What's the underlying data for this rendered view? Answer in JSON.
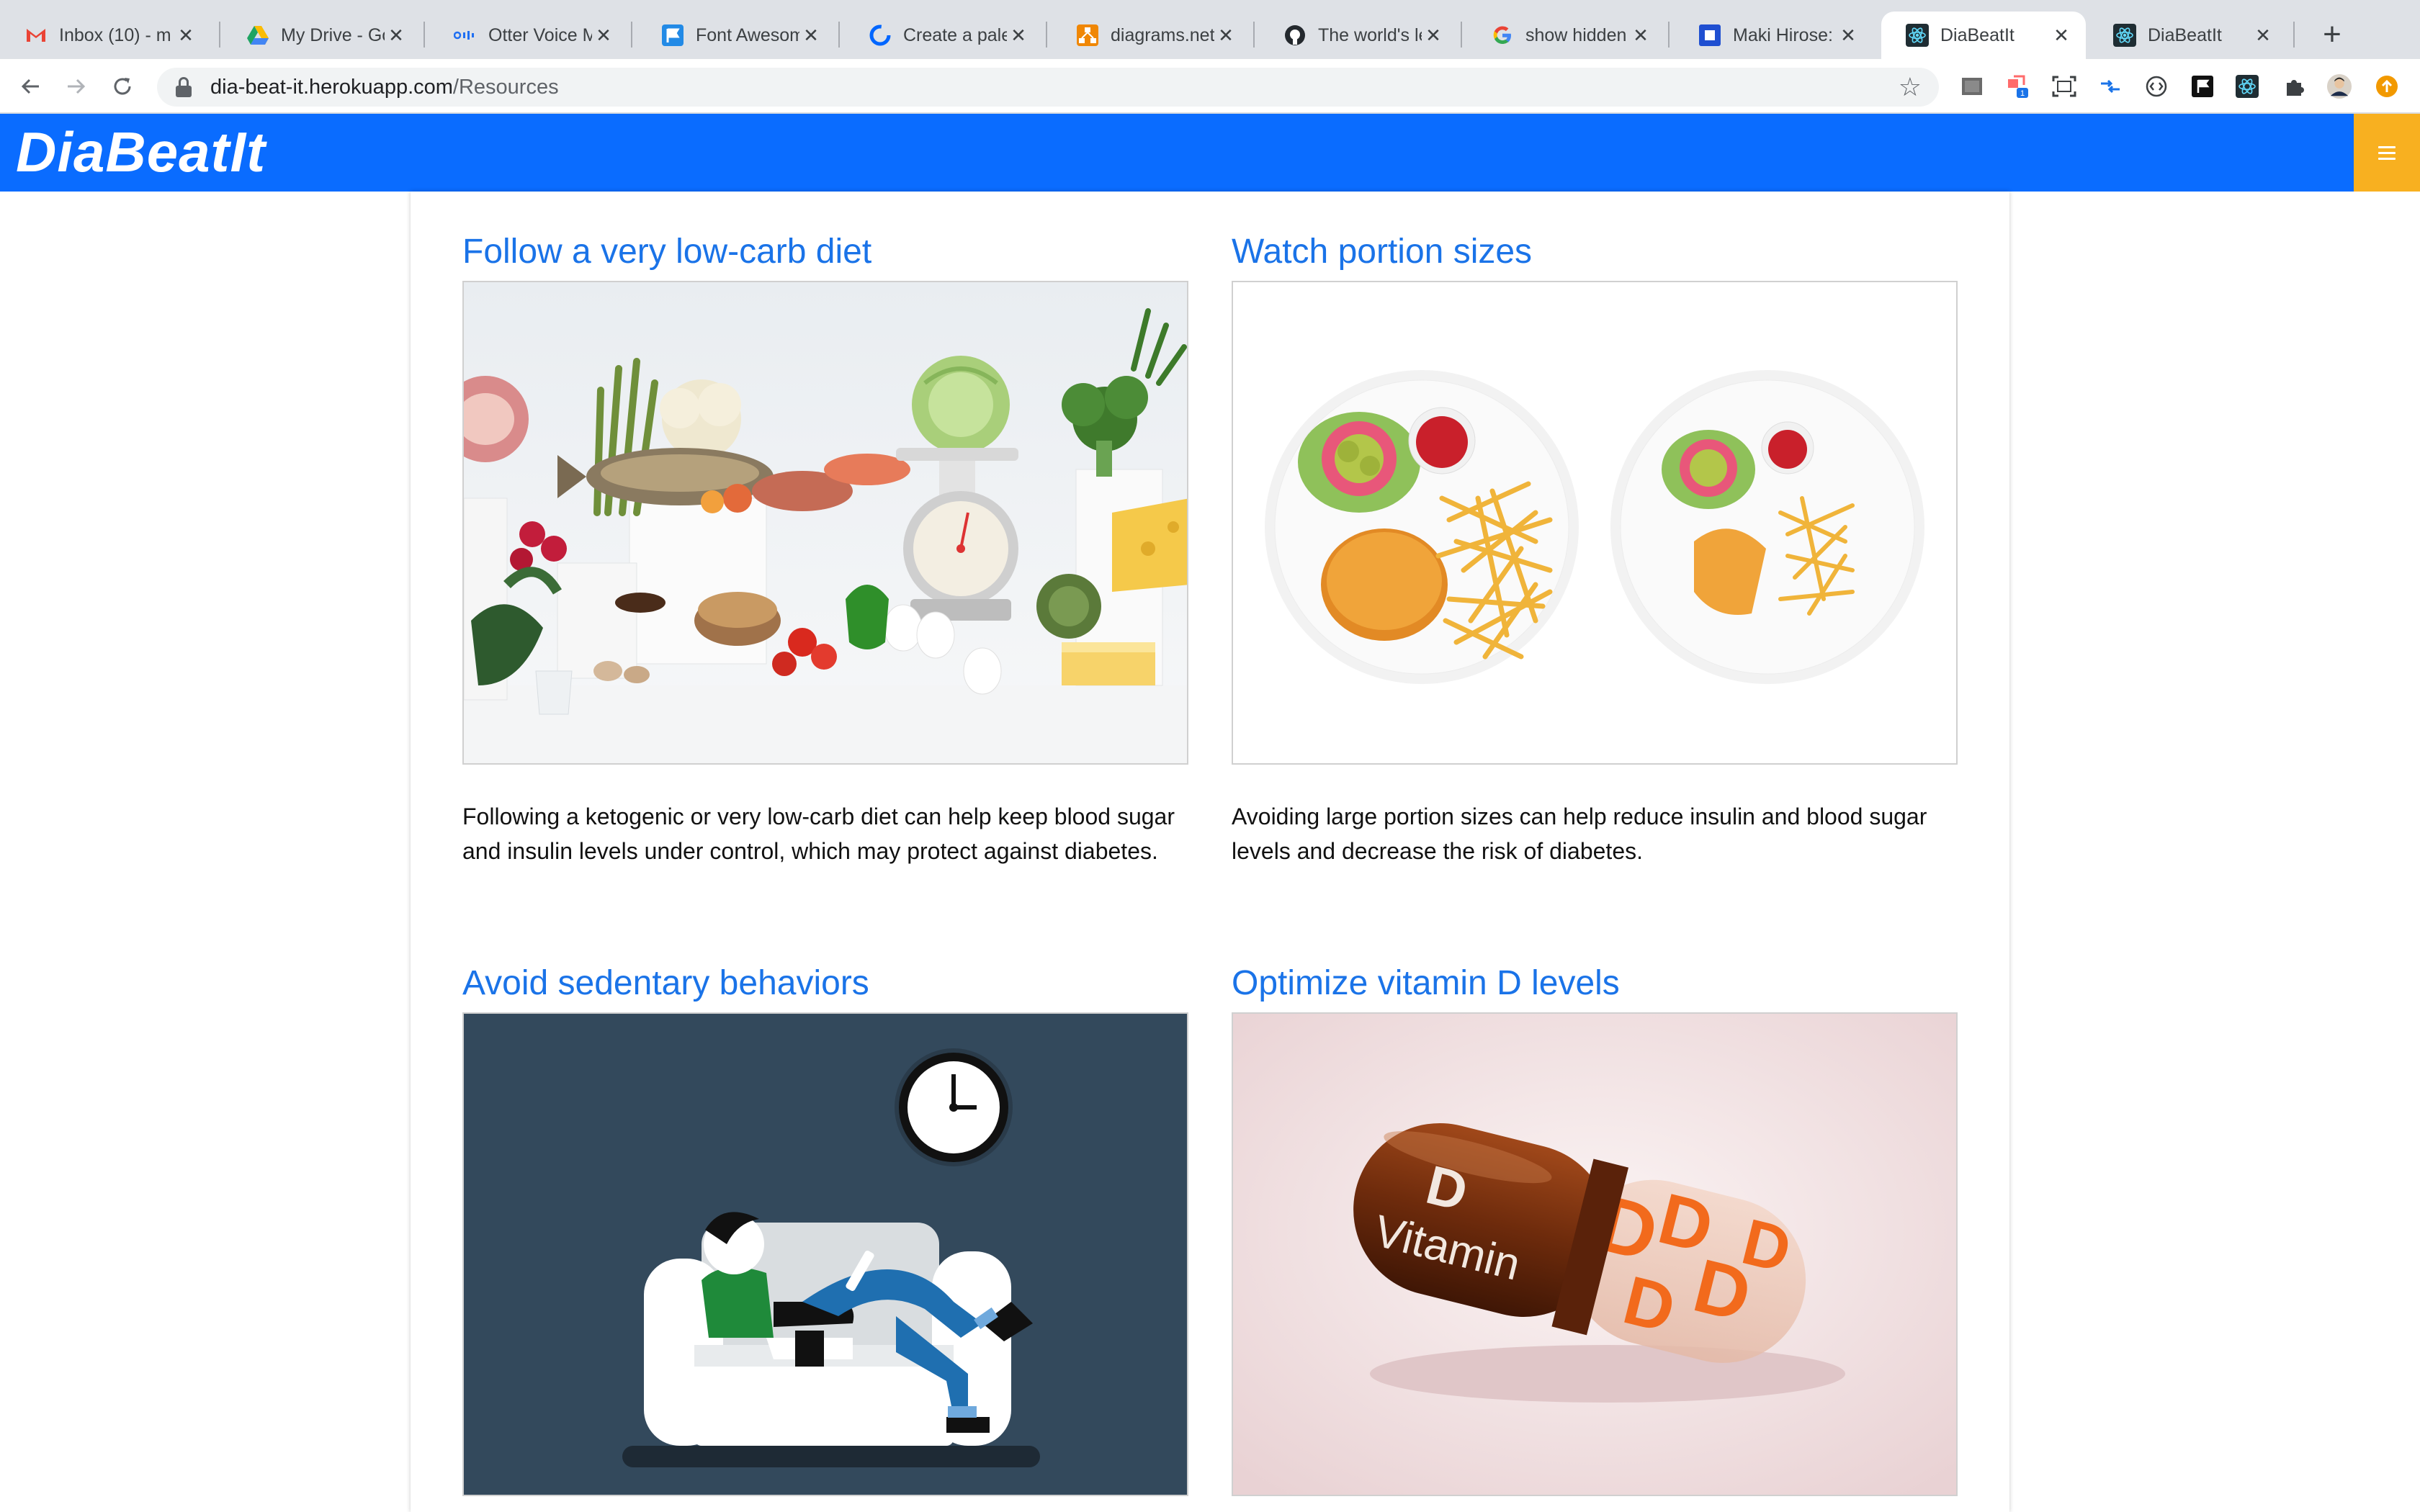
{
  "browser": {
    "tabs": [
      {
        "title": "Inbox (10) - m",
        "icon": "gmail-icon"
      },
      {
        "title": "My Drive - Go",
        "icon": "google-drive-icon"
      },
      {
        "title": "Otter Voice M",
        "icon": "otter-icon"
      },
      {
        "title": "Font Awesome",
        "icon": "font-awesome-flag-icon"
      },
      {
        "title": "Create a palet",
        "icon": "coolors-icon"
      },
      {
        "title": "diagrams.net",
        "icon": "diagrams-icon"
      },
      {
        "title": "The world's le",
        "icon": "github-icon"
      },
      {
        "title": "show hidden f",
        "icon": "google-icon"
      },
      {
        "title": "Maki Hirose: L",
        "icon": "square-app-icon"
      },
      {
        "title": "DiaBeatIt",
        "icon": "react-icon",
        "active": true
      },
      {
        "title": "DiaBeatIt",
        "icon": "react-icon"
      }
    ],
    "tab_close": "✕",
    "new_tab": "+",
    "url_host": "dia-beat-it.herokuapp.com",
    "url_path": "/Resources",
    "extension_badge": "1"
  },
  "app": {
    "brand": "DiaBeatIt",
    "brand_color": "#0a6cff",
    "menu_color": "#f8b020"
  },
  "resources": [
    {
      "title": "Follow a very low-carb diet",
      "image": "low-carb-foods-image",
      "description": "Following a ketogenic or very low-carb diet can help keep blood sugar and insulin levels under control, which may protect against diabetes."
    },
    {
      "title": "Watch portion sizes",
      "image": "portion-plates-image",
      "description": "Avoiding large portion sizes can help reduce insulin and blood sugar levels and decrease the risk of diabetes."
    },
    {
      "title": "Avoid sedentary behaviors",
      "image": "sedentary-couch-image",
      "description": ""
    },
    {
      "title": "Optimize vitamin D levels",
      "image": "vitamin-d-capsule-image",
      "description": "",
      "capsule_text_1": "D",
      "capsule_text_2": "Vitamin"
    }
  ]
}
